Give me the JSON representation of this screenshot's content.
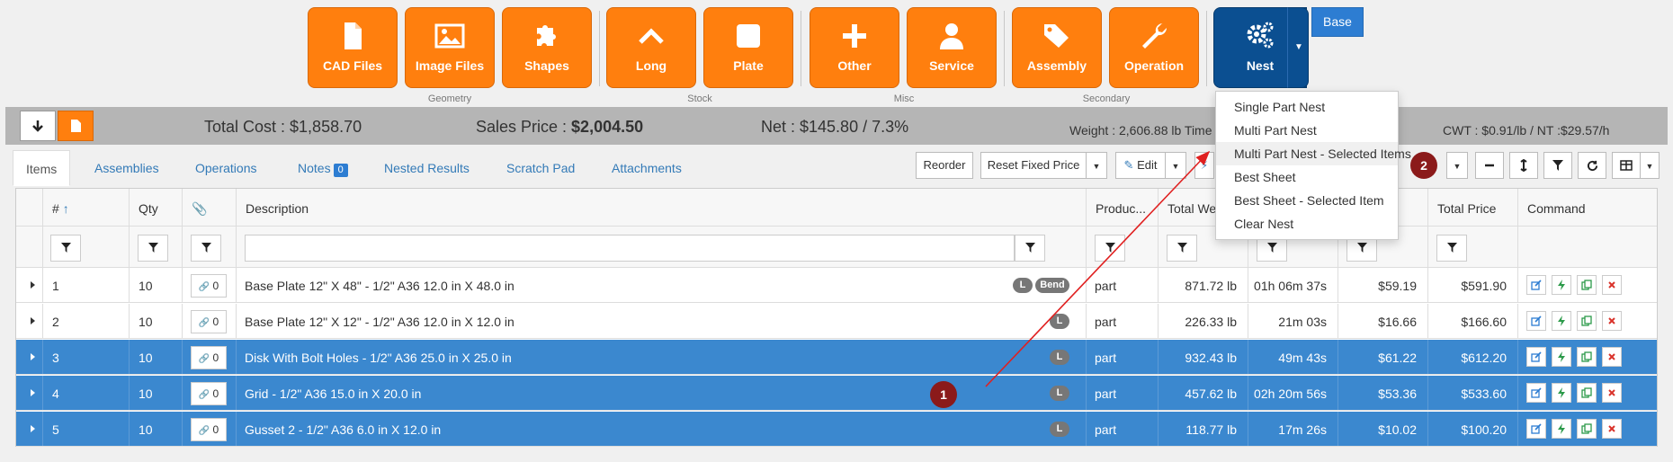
{
  "toolbar": {
    "buttons": [
      {
        "label": "CAD Files",
        "icon": "file-icon"
      },
      {
        "label": "Image Files",
        "icon": "image-icon"
      },
      {
        "label": "Shapes",
        "icon": "puzzle-icon"
      },
      {
        "label": "Long",
        "icon": "chevron-up-icon"
      },
      {
        "label": "Plate",
        "icon": "square-icon"
      },
      {
        "label": "Other",
        "icon": "plus-icon"
      },
      {
        "label": "Service",
        "icon": "user-icon"
      },
      {
        "label": "Assembly",
        "icon": "tags-icon"
      },
      {
        "label": "Operation",
        "icon": "wrench-icon"
      },
      {
        "label": "Nest",
        "icon": "gears-icon"
      }
    ],
    "groups": {
      "geometry": "Geometry",
      "stock": "Stock",
      "misc": "Misc",
      "secondary": "Secondary"
    },
    "base_label": "Base",
    "colors": {
      "orange": "#ff7f0e",
      "navy": "#0b4f91",
      "blue": "#2d7dd2"
    }
  },
  "summary": {
    "total_cost": "Total Cost : $1,858.70",
    "sales_price_label": "Sales Price : ",
    "sales_price_value": "$2,004.50",
    "net": "Net : $145.80 / 7.3%",
    "weight": "Weight : 2,606.88 lb Time",
    "cwt": "CWT : $0.91/lb / NT :$29.57/h"
  },
  "tabs": [
    {
      "label": "Items"
    },
    {
      "label": "Assemblies"
    },
    {
      "label": "Operations"
    },
    {
      "label": "Notes",
      "badge": "0"
    },
    {
      "label": "Nested Results"
    },
    {
      "label": "Scratch Pad"
    },
    {
      "label": "Attachments"
    }
  ],
  "actions": {
    "reorder": "Reorder",
    "reset_fixed_price": "Reset Fixed Price",
    "edit": "Edit"
  },
  "grid": {
    "headers": {
      "num": "#",
      "qty": "Qty",
      "description": "Description",
      "product": "Produc...",
      "weight": "Total Weigh",
      "price": "Total Price",
      "command": "Command"
    },
    "rows": [
      {
        "num": "1",
        "qty": "10",
        "attach": "0",
        "desc": "Base Plate 12\" X 48\" - 1/2\" A36 12.0 in X 48.0 in",
        "tags": [
          "L",
          "Bend"
        ],
        "product": "part",
        "weight": "871.72 lb",
        "time": "01h 06m 37s",
        "unit": "$59.19",
        "price": "$591.90",
        "selected": false
      },
      {
        "num": "2",
        "qty": "10",
        "attach": "0",
        "desc": "Base Plate 12\" X 12\" - 1/2\" A36 12.0 in X 12.0 in",
        "tags": [
          "L"
        ],
        "product": "part",
        "weight": "226.33 lb",
        "time": "21m 03s",
        "unit": "$16.66",
        "price": "$166.60",
        "selected": false
      },
      {
        "num": "3",
        "qty": "10",
        "attach": "0",
        "desc": "Disk With Bolt Holes - 1/2\" A36 25.0 in X 25.0 in",
        "tags": [
          "L"
        ],
        "product": "part",
        "weight": "932.43 lb",
        "time": "49m 43s",
        "unit": "$61.22",
        "price": "$612.20",
        "selected": true
      },
      {
        "num": "4",
        "qty": "10",
        "attach": "0",
        "desc": "Grid - 1/2\" A36 15.0 in X 20.0 in",
        "tags": [
          "L"
        ],
        "product": "part",
        "weight": "457.62 lb",
        "time": "02h 20m 56s",
        "unit": "$53.36",
        "price": "$533.60",
        "selected": true
      },
      {
        "num": "5",
        "qty": "10",
        "attach": "0",
        "desc": "Gusset 2 - 1/2\" A36 6.0 in X 12.0 in",
        "tags": [
          "L"
        ],
        "product": "part",
        "weight": "118.77 lb",
        "time": "17m 26s",
        "unit": "$10.02",
        "price": "$100.20",
        "selected": true
      }
    ]
  },
  "nest_menu": [
    "Single Part Nest",
    "Multi Part Nest",
    "Multi Part Nest - Selected Items",
    "Best Sheet",
    "Best Sheet - Selected Item",
    "Clear Nest"
  ],
  "markers": [
    "1",
    "2"
  ]
}
